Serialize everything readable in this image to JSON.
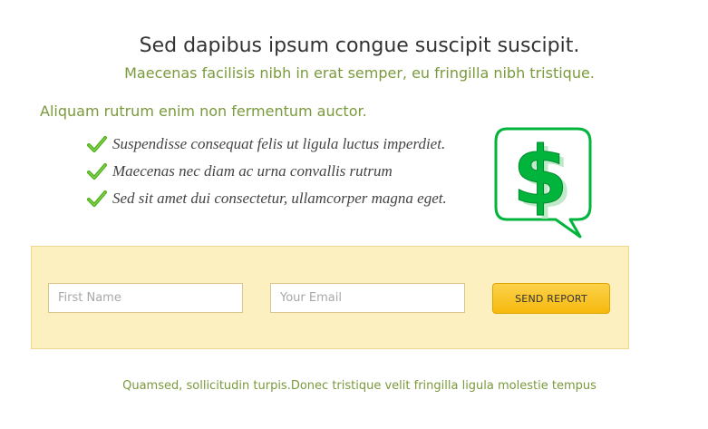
{
  "hero": {
    "title": "Sed dapibus ipsum congue suscipit suscipit.",
    "subtitle": "Maecenas facilisis nibh in erat semper, eu fringilla nibh tristique."
  },
  "features": {
    "heading": "Aliquam rutrum enim non fermentum auctor.",
    "items": [
      "Suspendisse consequat felis ut ligula luctus imperdiet.",
      "Maecenas nec diam ac urna convallis rutrum",
      "Sed sit amet dui consectetur, ullamcorper magna eget."
    ]
  },
  "icons": {
    "check": "checkmark-icon",
    "badge": "dollar-speech-bubble-icon"
  },
  "form": {
    "first_name_placeholder": "First Name",
    "email_placeholder": "Your Email",
    "submit_label": "SEND REPORT"
  },
  "footer": {
    "text": "Quamsed, sollicitudin turpis.Donec tristique velit fringilla ligula molestie tempus"
  },
  "colors": {
    "accent_green": "#7a9a3c",
    "icon_green": "#00b43c",
    "panel_background": "#fdf0c0",
    "button_yellow": "#f6b90e"
  }
}
